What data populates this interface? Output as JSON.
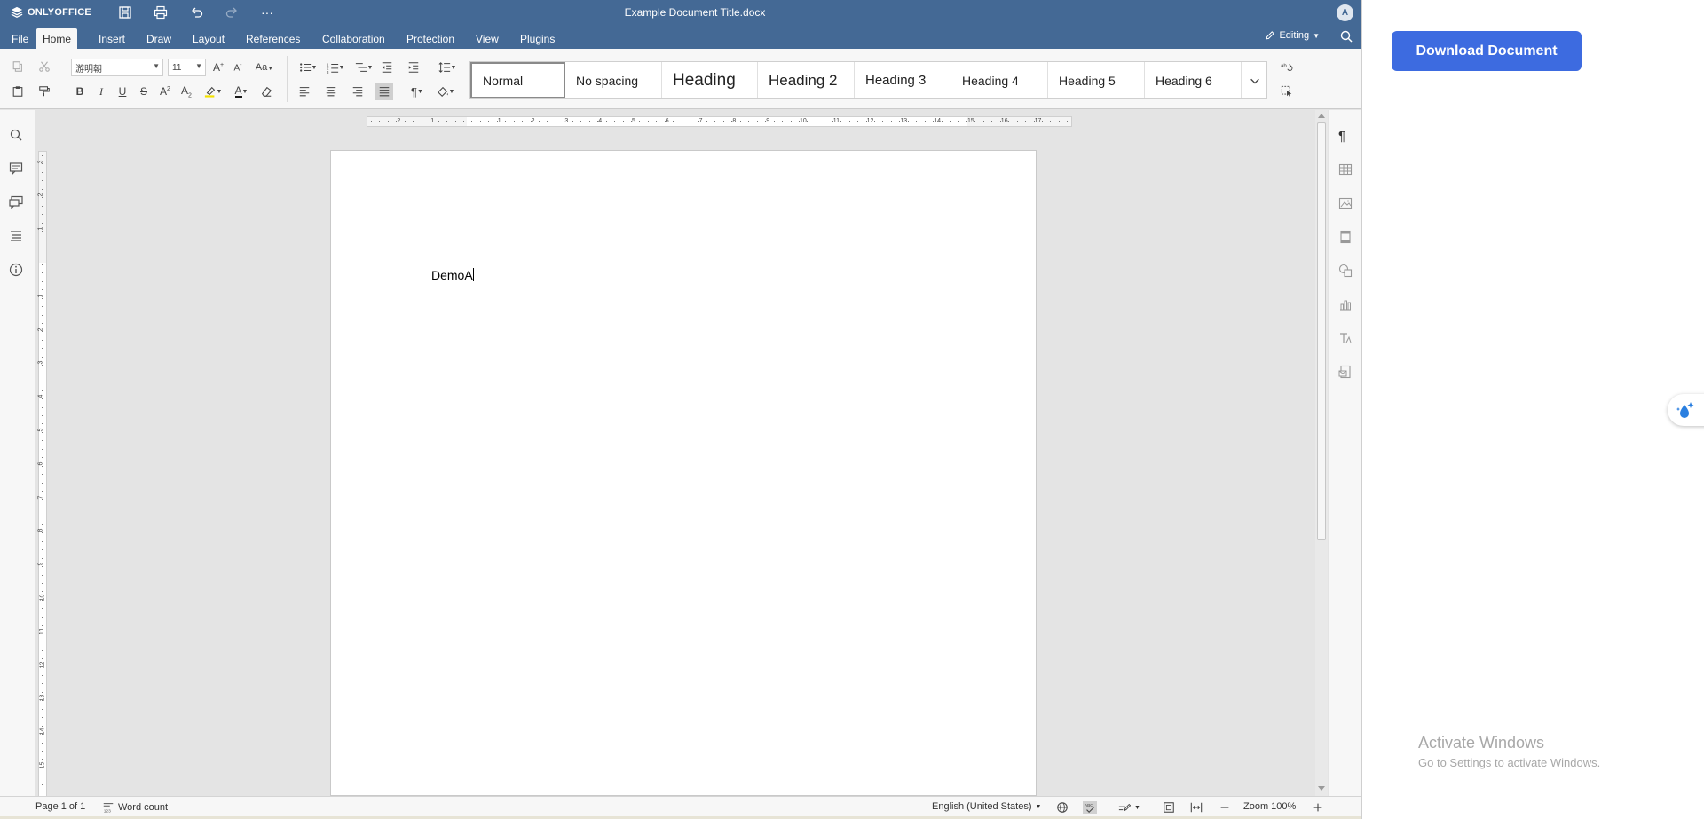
{
  "app": {
    "brand": "ONLYOFFICE",
    "document_title": "Example Document Title.docx",
    "user_initial": "A"
  },
  "colors": {
    "header": "#446995",
    "accent_button": "#3d6be0"
  },
  "header_icons": [
    "save-icon",
    "print-icon",
    "undo-icon",
    "redo-icon",
    "more-icon"
  ],
  "more_label": "···",
  "tabs": [
    {
      "label": "File"
    },
    {
      "label": "Home"
    },
    {
      "label": "Insert"
    },
    {
      "label": "Draw"
    },
    {
      "label": "Layout"
    },
    {
      "label": "References"
    },
    {
      "label": "Collaboration"
    },
    {
      "label": "Protection"
    },
    {
      "label": "View"
    },
    {
      "label": "Plugins"
    }
  ],
  "active_tab": "Home",
  "mode": {
    "label": "Editing"
  },
  "toolbar": {
    "font_name": "游明朝",
    "font_size": "11",
    "styles": [
      {
        "label": "Normal"
      },
      {
        "label": "No spacing"
      },
      {
        "label": "Heading"
      },
      {
        "label": "Heading 2"
      },
      {
        "label": "Heading 3"
      },
      {
        "label": "Heading 4"
      },
      {
        "label": "Heading 5"
      },
      {
        "label": "Heading 6"
      }
    ],
    "selected_style": "Normal"
  },
  "ruler": {
    "horizontal_numbers": [
      "2",
      "1",
      "1",
      "2",
      "3",
      "4",
      "5",
      "6",
      "7",
      "8",
      "9",
      "10",
      "11",
      "12",
      "13",
      "14",
      "15",
      "16",
      "17"
    ],
    "vertical_numbers": [
      "3",
      "2",
      "1",
      "1",
      "2",
      "3",
      "4",
      "5",
      "6",
      "7",
      "8",
      "9",
      "10",
      "11",
      "12",
      "13",
      "14",
      "15"
    ]
  },
  "document": {
    "text": "DemoA"
  },
  "status": {
    "page": "Page 1 of 1",
    "word_count": "Word count",
    "language": "English (United States)",
    "zoom": "Zoom 100%"
  },
  "download_button": "Download Document",
  "watermark": {
    "title": "Activate Windows",
    "subtitle": "Go to Settings to activate Windows."
  }
}
